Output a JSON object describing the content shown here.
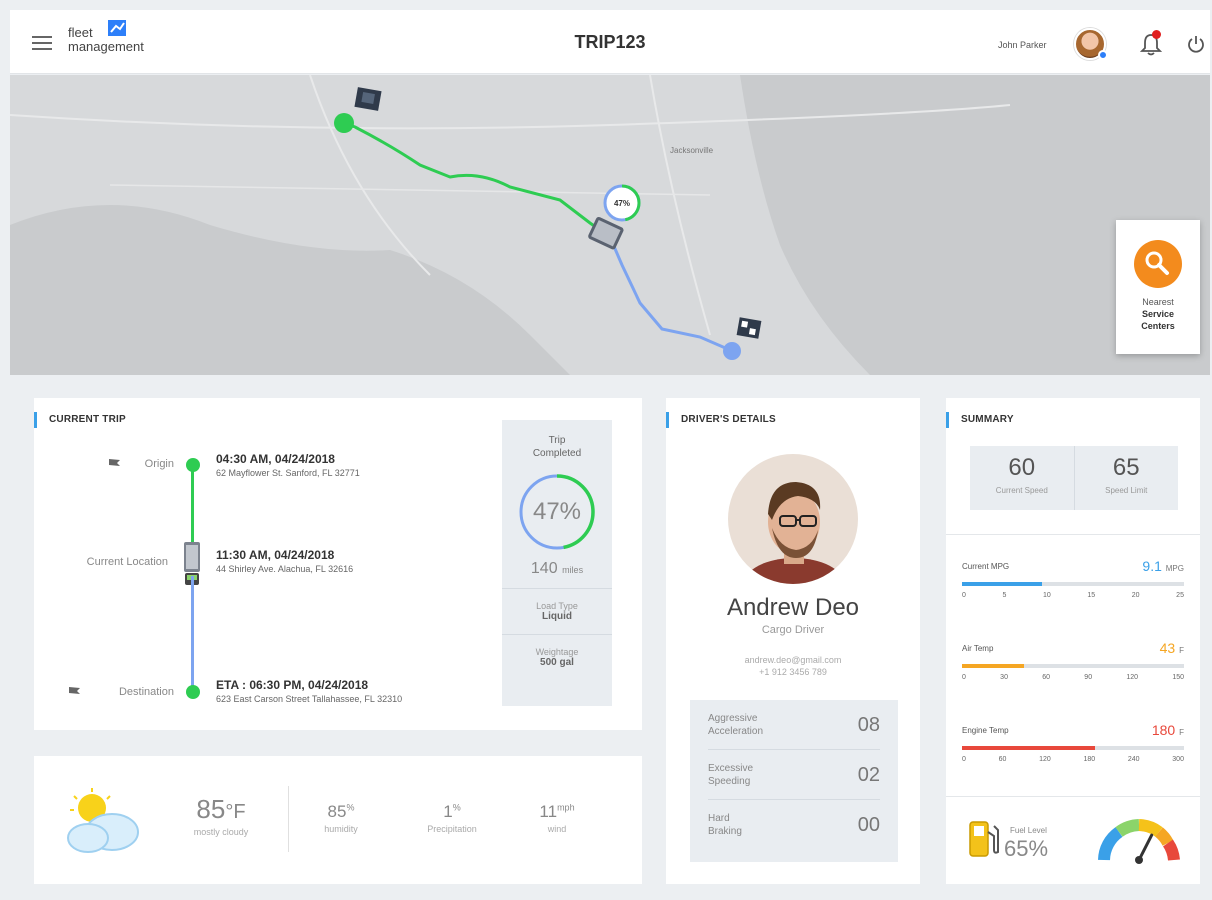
{
  "header": {
    "logo_line1": "fleet",
    "logo_line2": "management",
    "trip_id": "TRIP123",
    "user_name": "John Parker"
  },
  "map": {
    "progress_label": "47%",
    "service_btn": {
      "line1": "Nearest",
      "line2": "Service",
      "line3": "Centers"
    },
    "city_label": "Jacksonville"
  },
  "current_trip": {
    "title": "CURRENT TRIP",
    "origin": {
      "label": "Origin",
      "time": "04:30 AM, 04/24/2018",
      "address": "62 Mayflower St. Sanford, FL 32771"
    },
    "current": {
      "label": "Current Location",
      "time": "11:30 AM, 04/24/2018",
      "address": "44 Shirley Ave. Alachua, FL 32616"
    },
    "destination": {
      "label": "Destination",
      "time": "ETA : 06:30 PM, 04/24/2018",
      "address": "623 East Carson Street Tallahassee, FL 32310"
    },
    "side": {
      "completed_line1": "Trip",
      "completed_line2": "Completed",
      "percent": "47%",
      "percent_value": 47,
      "miles": "140",
      "miles_unit": "miles",
      "load_type_label": "Load Type",
      "load_type_value": "Liquid",
      "weightage_label": "Weightage",
      "weightage_value": "500 gal"
    }
  },
  "weather": {
    "temp": "85",
    "temp_unit": "°F",
    "condition": "mostly cloudy",
    "humidity": "85",
    "humidity_unit": "%",
    "humidity_label": "humidity",
    "precip": "1",
    "precip_unit": "%",
    "precip_label": "Precipitation",
    "wind": "11",
    "wind_unit": "mph",
    "wind_label": "wind"
  },
  "driver": {
    "title": "DRIVER'S DETAILS",
    "name": "Andrew Deo",
    "role": "Cargo Driver",
    "email": "andrew.deo@gmail.com",
    "phone": "+1 912 3456 789",
    "stats": [
      {
        "line1": "Aggressive",
        "line2": "Acceleration",
        "value": "08"
      },
      {
        "line1": "Excessive",
        "line2": "Speeding",
        "value": "02"
      },
      {
        "line1": "Hard",
        "line2": "Braking",
        "value": "00"
      }
    ]
  },
  "summary": {
    "title": "SUMMARY",
    "current_speed": "60",
    "current_speed_label": "Current Speed",
    "speed_limit": "65",
    "speed_limit_label": "Speed Limit",
    "mpg": {
      "label": "Current MPG",
      "value": "9.1",
      "unit": "MPG",
      "fraction": 0.36,
      "color": "#3aa0e8",
      "ticks": [
        "0",
        "5",
        "10",
        "15",
        "20",
        "25"
      ]
    },
    "air_temp": {
      "label": "Air Temp",
      "value": "43",
      "unit": "F",
      "fraction": 0.28,
      "color": "#f5a623",
      "ticks": [
        "0",
        "30",
        "60",
        "90",
        "120",
        "150"
      ]
    },
    "engine_temp": {
      "label": "Engine Temp",
      "value": "180",
      "unit": "F",
      "fraction": 0.6,
      "color": "#e8483b",
      "ticks": [
        "0",
        "60",
        "120",
        "180",
        "240",
        "300"
      ]
    },
    "fuel_label": "Fuel Level",
    "fuel_value": "65%",
    "fuel_fraction": 0.65
  },
  "colors": {
    "accent_blue": "#3aa0e8",
    "route_green": "#2ecc52",
    "route_blue": "#7da4f0",
    "service_orange": "#f38b1d"
  }
}
